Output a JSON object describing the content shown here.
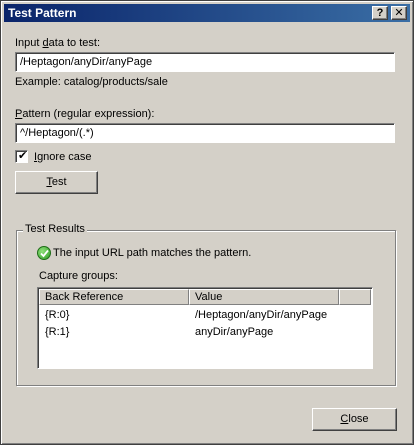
{
  "window": {
    "title": "Test Pattern",
    "help_glyph": "?",
    "close_glyph": "✕"
  },
  "input_section": {
    "label": "Input data to test:",
    "value": "/Heptagon/anyDir/anyPage",
    "example": "Example: catalog/products/sale"
  },
  "pattern_section": {
    "label": "Pattern (regular expression):",
    "value": "^/Heptagon/(.*)"
  },
  "ignore_case": {
    "label": "Ignore case",
    "checked": true,
    "check_glyph": "✔"
  },
  "test_button": {
    "label": "Test"
  },
  "results": {
    "group_title": "Test Results",
    "message": "The input URL path matches the pattern.",
    "capture_label": "Capture groups:",
    "columns": [
      "Back Reference",
      "Value"
    ],
    "rows": [
      {
        "ref": "{R:0}",
        "value": "/Heptagon/anyDir/anyPage"
      },
      {
        "ref": "{R:1}",
        "value": "anyDir/anyPage"
      }
    ]
  },
  "close_button": {
    "label": "Close"
  },
  "colors": {
    "title_start": "#0a246a",
    "title_end": "#3a6ea5",
    "dialog_bg": "#d4d0c8",
    "success_green": "#2e9b25"
  }
}
